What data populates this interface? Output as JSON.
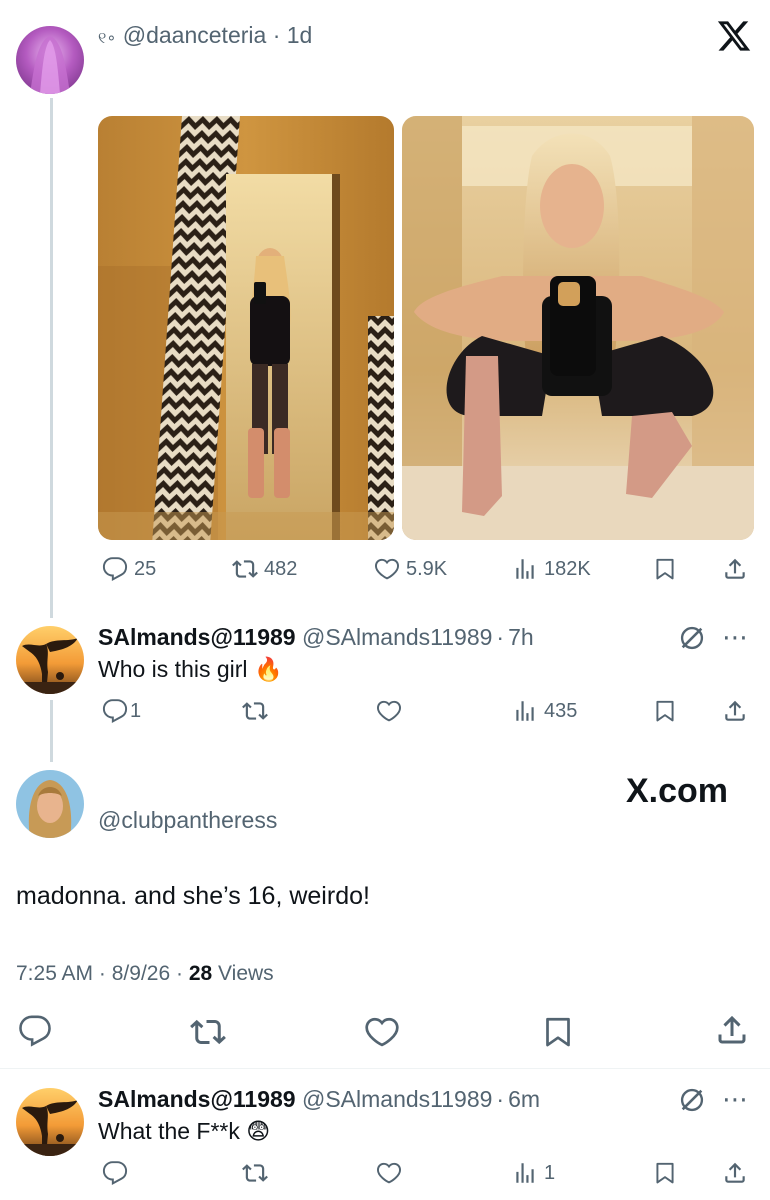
{
  "post1": {
    "handle_prefix": "୧∘",
    "handle": "@daanceteria",
    "separator": "·",
    "time": "1d",
    "stats": {
      "replies": "25",
      "reposts": "482",
      "likes": "5.9K",
      "views": "182K"
    }
  },
  "reply1": {
    "name": "SAlmands@11989",
    "handle": "@SAlmands11989",
    "separator": "·",
    "time": "7h",
    "text": "Who is this girl",
    "emoji": "🔥",
    "stats": {
      "replies": "1",
      "views": "435"
    }
  },
  "main": {
    "handle": "@clubpantheress",
    "text": "madonna. and she’s 16, weirdo!",
    "time": "7:25 AM",
    "date": "8/9/26",
    "separator": "·",
    "views_count": "28",
    "views_label": "Views",
    "watermark": "X.com"
  },
  "reply2": {
    "name": "SAlmands@11989",
    "handle": "@SAlmands11989",
    "separator": "·",
    "time": "6m",
    "text": "What the F**k",
    "emoji": "😨",
    "stats": {
      "views": "1"
    }
  },
  "brand": {
    "x_logo": "𝕏"
  },
  "colors": {
    "text": "#0f1419",
    "muted": "#536471",
    "thread_line": "#cfd9de"
  }
}
